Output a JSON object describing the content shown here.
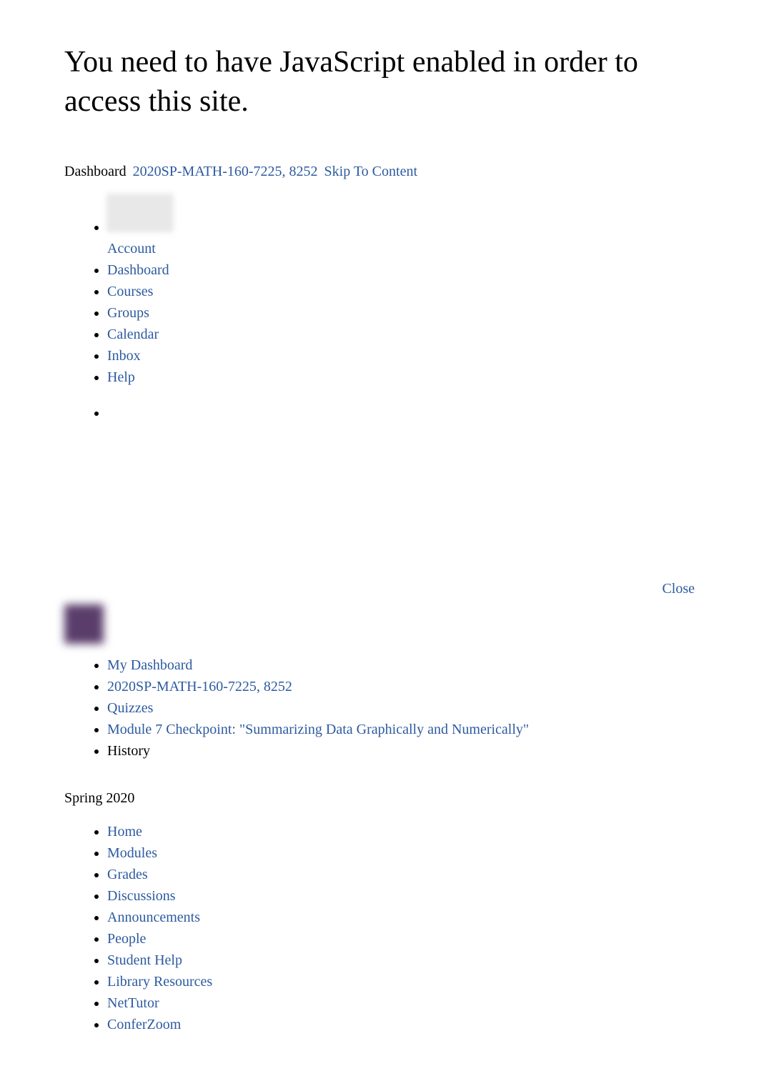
{
  "page": {
    "heading": "You need to have JavaScript enabled in order to access this site."
  },
  "header": {
    "dashboard_label": "Dashboard",
    "course_link": "2020SP-MATH-160-7225, 8252",
    "skip_link": "Skip To Content"
  },
  "global_nav": {
    "account": "Account",
    "dashboard": "Dashboard",
    "courses": "Courses",
    "groups": "Groups",
    "calendar": "Calendar",
    "inbox": "Inbox",
    "help": "Help"
  },
  "close_label": "Close",
  "breadcrumb": {
    "my_dashboard": "My Dashboard",
    "course": "2020SP-MATH-160-7225, 8252",
    "quizzes": "Quizzes",
    "quiz_title": "Module 7 Checkpoint: \"Summarizing Data Graphically and Numerically\"",
    "history": "History"
  },
  "term": "Spring 2020",
  "course_nav": {
    "home": "Home",
    "modules": "Modules",
    "grades": "Grades",
    "discussions": "Discussions",
    "announcements": "Announcements",
    "people": "People",
    "student_help": "Student Help",
    "library_resources": "Library Resources",
    "nettutor": "NetTutor",
    "conferzoom": "ConferZoom"
  }
}
